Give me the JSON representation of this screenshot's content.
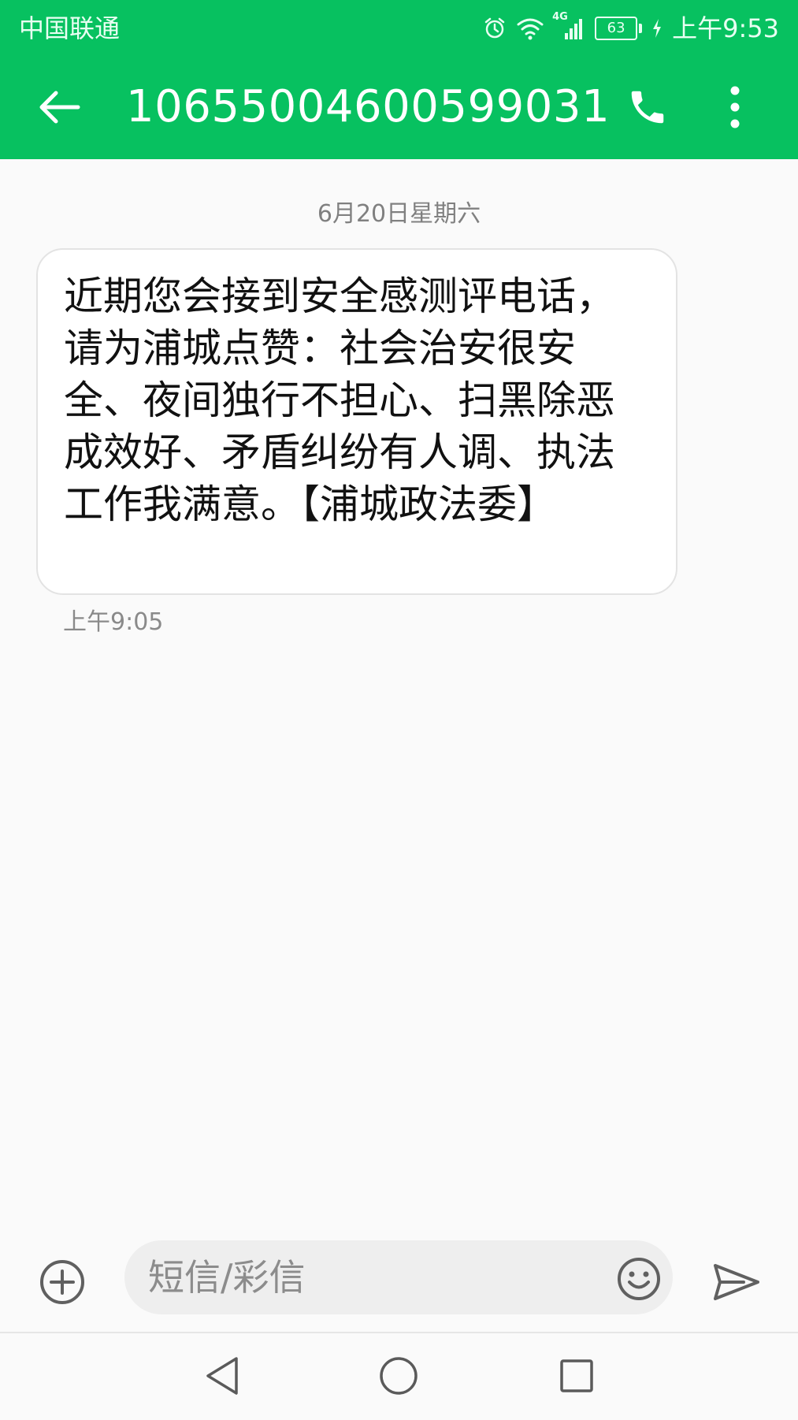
{
  "status_bar": {
    "carrier": "中国联通",
    "network": "4G",
    "battery": "63",
    "time": "上午9:53"
  },
  "toolbar": {
    "title": "10655004600599031"
  },
  "conversation": {
    "date_separator": "6月20日星期六",
    "messages": [
      {
        "text": "近期您会接到安全感测评电话，请为浦城点赞：社会治安很安全、夜间独行不担心、扫黑除恶成效好、矛盾纠纷有人调、执法工作我满意。【浦城政法委】",
        "time": "上午9:05"
      }
    ]
  },
  "composer": {
    "placeholder": "短信/彩信",
    "value": ""
  },
  "colors": {
    "header": "#07c160",
    "background": "#fafafa",
    "bubble": "#ffffff"
  },
  "icons": {
    "back": "arrow-left-icon",
    "call": "phone-icon",
    "more": "more-vertical-icon",
    "attach": "plus-circle-icon",
    "emoji": "smiley-icon",
    "send": "send-icon",
    "nav_back": "triangle-back-icon",
    "nav_home": "circle-home-icon",
    "nav_recents": "square-recents-icon"
  }
}
